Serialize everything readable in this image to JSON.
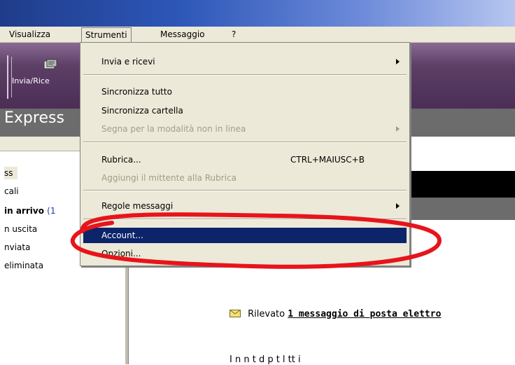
{
  "menubar": {
    "items": [
      {
        "label": "Visualizza"
      },
      {
        "label": "Strumenti"
      },
      {
        "label": "Messaggio"
      },
      {
        "label": "?"
      }
    ]
  },
  "toolbar": {
    "send_receive_label": "Invia/Rice"
  },
  "brand": {
    "text": "Express"
  },
  "folders": [
    {
      "label": "ss"
    },
    {
      "label": "cali"
    },
    {
      "label": "in arrivo",
      "count": "(1"
    },
    {
      "label": "n uscita"
    },
    {
      "label": "nviata"
    },
    {
      "label": "eliminata"
    }
  ],
  "dropdown": {
    "items": [
      {
        "label": "Invia e ricevi"
      },
      {
        "label": "Sincronizza tutto"
      },
      {
        "label": "Sincronizza cartella"
      },
      {
        "label": "Segna per la modalità non in linea"
      },
      {
        "label": "Rubrica...",
        "shortcut": "CTRL+MAIUSC+B"
      },
      {
        "label": "Aggiungi il mittente alla Rubrica"
      },
      {
        "label": "Regole messaggi"
      },
      {
        "label": "Account..."
      },
      {
        "label": "Opzioni..."
      }
    ]
  },
  "content": {
    "notice_prefix": "Rilevato",
    "notice_link": "1 messaggio di posta elettro",
    "bottom_text": "I n  n      t    d  p    t  l   tt   i"
  },
  "colors": {
    "highlight": "#0b246a",
    "annotation": "#e8141b",
    "toolbar": "#5d3f66"
  }
}
